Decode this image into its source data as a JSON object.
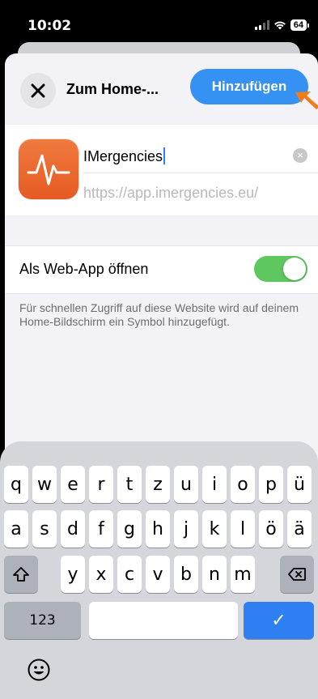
{
  "status": {
    "time": "10:02",
    "battery": "64"
  },
  "header": {
    "title": "Zum Home-...",
    "add_label": "Hinzufügen"
  },
  "bookmark": {
    "name_value": "IMergencies",
    "url": "https://app.imergencies.eu/"
  },
  "webapp": {
    "label": "Als Web-App öffnen",
    "enabled": true,
    "description": "Für schnellen Zugriff auf diese Website wird auf deinem Home-Bildschirm ein Symbol hinzugefügt."
  },
  "colors": {
    "accent": "#3591f2",
    "toggle_on": "#5ec760",
    "app_icon": "#ec6a2e",
    "pointer": "#f07d1a"
  },
  "keyboard": {
    "row1": [
      "q",
      "w",
      "e",
      "r",
      "t",
      "z",
      "u",
      "i",
      "o",
      "p",
      "ü"
    ],
    "row2": [
      "a",
      "s",
      "d",
      "f",
      "g",
      "h",
      "j",
      "k",
      "l",
      "ö",
      "ä"
    ],
    "row3": [
      "y",
      "x",
      "c",
      "v",
      "b",
      "n",
      "m"
    ],
    "numbers_label": "123",
    "done_label": "✓",
    "shift_icon": "shift-icon",
    "delete_icon": "delete-icon",
    "emoji_icon": "emoji-icon"
  }
}
